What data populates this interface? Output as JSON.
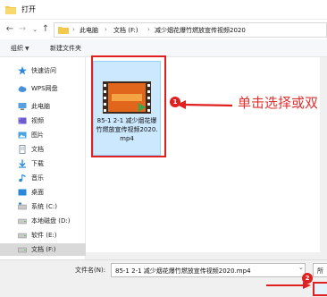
{
  "window": {
    "title": "打开"
  },
  "address": {
    "crumbs": [
      "此电脑",
      "文档 (F:)",
      "减少烟花爆竹燃放宣传视频2020"
    ],
    "separator": "›"
  },
  "toolbar": {
    "organize": "组织",
    "new_folder": "新建文件夹"
  },
  "sidebar": {
    "items": [
      {
        "label": "快速访问",
        "icon": "star-icon"
      },
      {
        "label": "WPS网盘",
        "icon": "cloud-icon"
      },
      {
        "label": "此电脑",
        "icon": "computer-icon"
      },
      {
        "label": "视频",
        "icon": "video-folder-icon"
      },
      {
        "label": "图片",
        "icon": "pictures-folder-icon"
      },
      {
        "label": "文档",
        "icon": "documents-folder-icon"
      },
      {
        "label": "下载",
        "icon": "download-folder-icon"
      },
      {
        "label": "音乐",
        "icon": "music-folder-icon"
      },
      {
        "label": "桌面",
        "icon": "desktop-folder-icon"
      },
      {
        "label": "系统 (C:)",
        "icon": "drive-icon"
      },
      {
        "label": "本地磁盘 (D:)",
        "icon": "drive-icon"
      },
      {
        "label": "软件 (E:)",
        "icon": "drive-icon"
      },
      {
        "label": "文档 (F:)",
        "icon": "drive-icon",
        "selected": true
      }
    ]
  },
  "file": {
    "name": "85-1 2-1 减少烟花爆竹燃放宣传视频2020.mp4"
  },
  "bottom": {
    "filename_label": "文件名(N):",
    "filename_value": "85-1 2-1 减少烟花爆竹燃放宣传视频2020.mp4",
    "filter_label": "所"
  },
  "annotations": {
    "step1": "1",
    "step2": "2",
    "instruction": "单击选择或双",
    "color": "#e02020"
  }
}
